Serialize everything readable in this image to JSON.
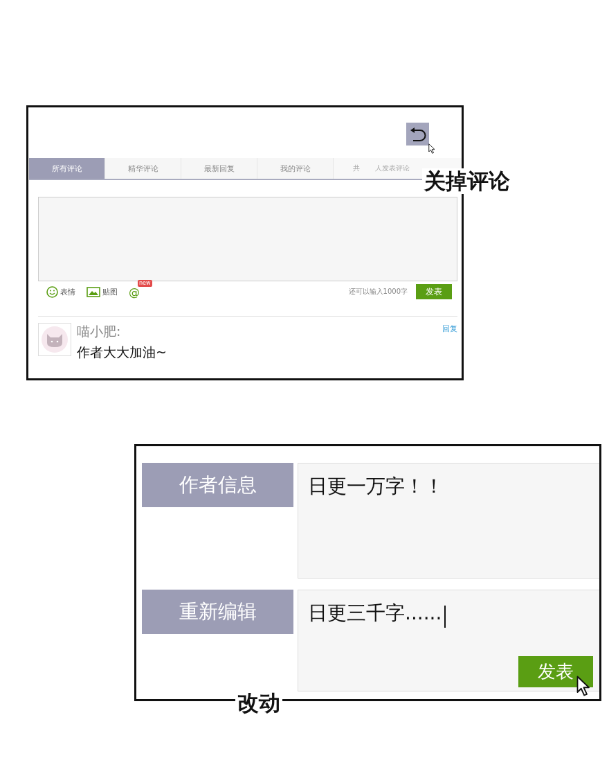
{
  "comment_panel": {
    "close_caption": "关掉评论",
    "tabs": [
      {
        "label": "所有评论",
        "selected": true
      },
      {
        "label": "精华评论",
        "selected": false
      },
      {
        "label": "最新回复",
        "selected": false
      },
      {
        "label": "我的评论",
        "selected": false
      }
    ],
    "tab_stats": [
      "共",
      "人发表评论"
    ],
    "toolbar": [
      {
        "kind": "emoji",
        "label": "表情"
      },
      {
        "kind": "image",
        "label": "贴图"
      },
      {
        "kind": "mention",
        "label": "@",
        "badge": "new"
      }
    ],
    "remaining": "还可以输入1000字",
    "submit": "发表",
    "comments": [
      {
        "user": "喵小肥:",
        "text": "作者大大加油~",
        "reply": "回复"
      }
    ]
  },
  "edit_panel": {
    "caption": "改动",
    "rows": [
      {
        "label": "作者信息",
        "value": "日更一万字！！",
        "focused": false
      },
      {
        "label": "重新编辑",
        "value": "日更三千字......",
        "focused": true,
        "button": "发表"
      }
    ]
  }
}
